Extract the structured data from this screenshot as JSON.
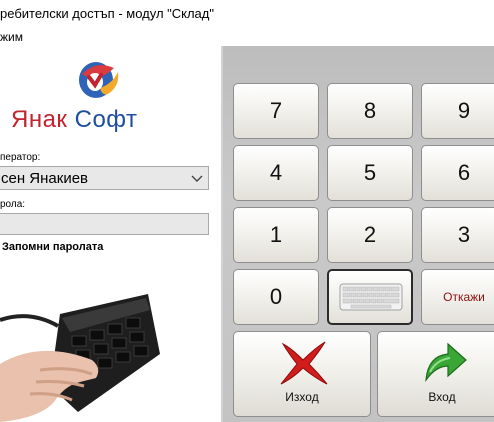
{
  "window": {
    "title": "ребителски достъп - модул \"Склад\""
  },
  "menu": {
    "item": "жим"
  },
  "logo": {
    "text_part1": "Янак",
    "text_part2": "Софт"
  },
  "form": {
    "operator_label": "ператор:",
    "operator_value": "сен Янакиев",
    "password_label": "рола:",
    "password_value": "",
    "remember_label": "Запомни паролата"
  },
  "keypad": {
    "keys": [
      "7",
      "8",
      "9",
      "4",
      "5",
      "6",
      "1",
      "2",
      "3",
      "0"
    ],
    "cancel_label": "Откажи",
    "keyboard_icon": "keyboard-icon"
  },
  "actions": {
    "exit_label": "Изход",
    "enter_label": "Вход",
    "exit_icon": "red-x-icon",
    "enter_icon": "green-arrow-icon"
  },
  "colors": {
    "accent_red": "#c2232e",
    "accent_blue": "#1d4f9c",
    "cancel_text": "#8b1010"
  }
}
